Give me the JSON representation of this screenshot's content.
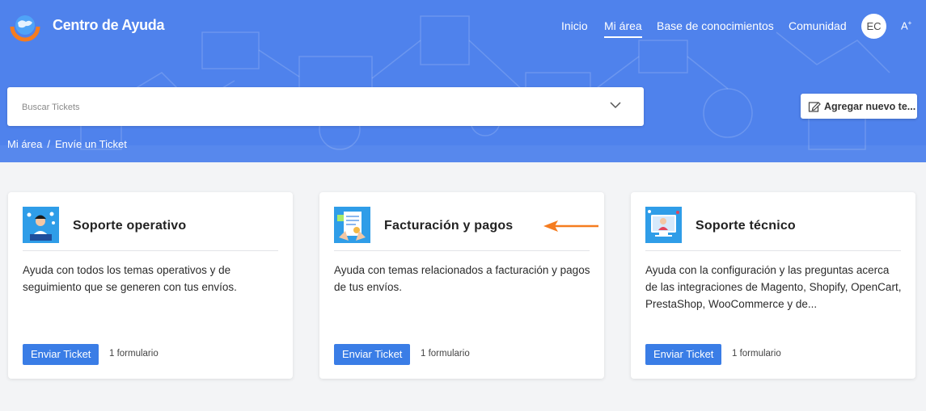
{
  "header": {
    "brand": "Centro de Ayuda",
    "nav": [
      {
        "label": "Inicio"
      },
      {
        "label": "Mi área"
      },
      {
        "label": "Base de conocimientos"
      },
      {
        "label": "Comunidad"
      }
    ],
    "active_nav": "Mi área",
    "avatar_initials": "EC",
    "font_toggle": "A",
    "font_toggle_sup": "+"
  },
  "search": {
    "placeholder": "Buscar Tickets",
    "icon": "chevron-down-icon"
  },
  "add_button": {
    "label": "Agregar nuevo te...",
    "icon": "edit-icon"
  },
  "breadcrumb": {
    "items": [
      "Mi área",
      "Envíe un Ticket"
    ],
    "separator": "/"
  },
  "cards": [
    {
      "title": "Soporte operativo",
      "description": "Ayuda con todos los temas operativos y de seguimiento que se generen con tus envíos.",
      "button": "Enviar Ticket",
      "count": "1 formulario",
      "icon": "operator-icon"
    },
    {
      "title": "Facturación y pagos",
      "description": "Ayuda con temas relacionados a facturación y pagos de tus envíos.",
      "button": "Enviar Ticket",
      "count": "1 formulario",
      "icon": "invoice-icon"
    },
    {
      "title": "Soporte técnico",
      "description": "Ayuda con la configuración y las preguntas acerca de las integraciones de Magento, Shopify, OpenCart, PrestaShop, WooCommerce y de...",
      "button": "Enviar Ticket",
      "count": "1 formulario",
      "icon": "tech-support-icon"
    }
  ],
  "colors": {
    "hero": "#4f82ec",
    "accent_button": "#3a7de6",
    "annotation_arrow": "#f57c1f"
  }
}
